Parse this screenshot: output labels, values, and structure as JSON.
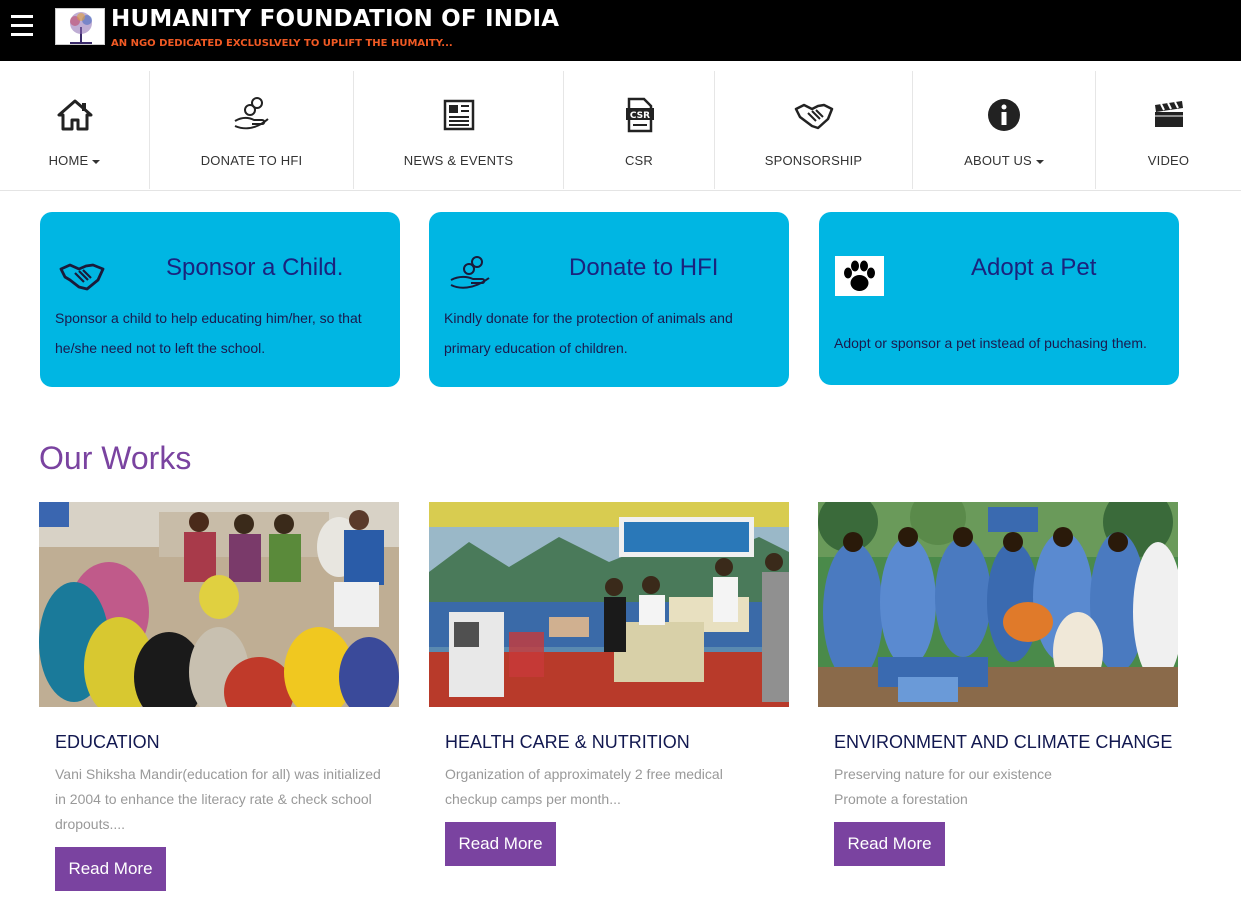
{
  "header": {
    "title": "HUMANITY FOUNDATION OF INDIA",
    "tagline": "AN NGO DEDICATED EXCLUSLVELY TO UPLIFT THE HUMAITY..."
  },
  "nav": {
    "items": [
      {
        "label": "HOME",
        "icon": "home-icon",
        "dropdown": true
      },
      {
        "label": "DONATE TO HFI",
        "icon": "donate-hand-icon",
        "dropdown": false
      },
      {
        "label": "NEWS & EVENTS",
        "icon": "newspaper-icon",
        "dropdown": false
      },
      {
        "label": "CSR",
        "icon": "csr-document-icon",
        "dropdown": false
      },
      {
        "label": "SPONSORSHIP",
        "icon": "handshake-icon",
        "dropdown": false
      },
      {
        "label": "ABOUT US",
        "icon": "info-icon",
        "dropdown": true
      },
      {
        "label": "VIDEO",
        "icon": "clapperboard-icon",
        "dropdown": false
      }
    ]
  },
  "cards": [
    {
      "title": "Sponsor a Child.",
      "icon": "handshake-icon",
      "description": "Sponsor a child to help educating him/her, so that he/she need not to left the school."
    },
    {
      "title": "Donate to HFI",
      "icon": "donate-hand-icon",
      "description": "Kindly donate for the protection of animals and primary education of children."
    },
    {
      "title": "Adopt a Pet",
      "icon": "paw-icon",
      "description": "Adopt or sponsor a pet instead of puchasing them."
    }
  ],
  "works": {
    "heading": "Our Works",
    "items": [
      {
        "title": "EDUCATION",
        "description": "Vani Shiksha Mandir(education for all) was initialized in 2004 to enhance the literacy rate & check school dropouts....",
        "button": "Read More"
      },
      {
        "title": "HEALTH CARE & NUTRITION",
        "description": "Organization of approximately 2 free medical checkup camps per month...",
        "button": "Read More"
      },
      {
        "title": "ENVIRONMENT AND CLIMATE CHANGE",
        "description_lines": [
          "Preserving nature for our existence",
          "Promote a forestation"
        ],
        "button": "Read More"
      }
    ]
  },
  "colors": {
    "topbar": "#000000",
    "tagline": "#f15a24",
    "card": "#00b6e3",
    "card_title": "#1a237e",
    "accent_purple": "#7a43a0"
  }
}
